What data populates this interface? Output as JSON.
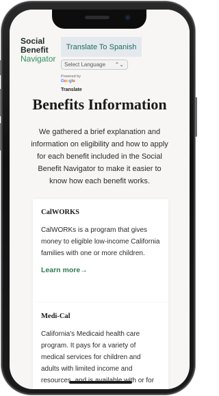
{
  "header": {
    "brand_line1": "Social",
    "brand_line2": "Benefit",
    "brand_line3": "Navigator",
    "translate_button": "Translate To Spanish",
    "language_select": "Select Language",
    "powered_by": "Powered by",
    "google": "Google",
    "translate_link": "Translate"
  },
  "main": {
    "title": "Benefits Information",
    "intro": "We gathered a brief explanation and information on eligibility and how to apply for each benefit included in the Social Benefit Navigator to make it easier to know how each benefit works."
  },
  "cards": [
    {
      "title": "CalWORKS",
      "body": "CalWORKs is a program that gives money to eligible low-income California families with one or more children.",
      "link": "Learn more",
      "link_arrow": "→"
    },
    {
      "title": "Medi-Cal",
      "body": "California's Medicaid health care program. It pays for a variety of medical services for children and adults with limited income and resources, and is available with or for"
    }
  ],
  "colors": {
    "accent_green": "#2f8f5b",
    "translate_button_bg": "#e4e9ef",
    "page_bg": "#f7f6f4"
  }
}
